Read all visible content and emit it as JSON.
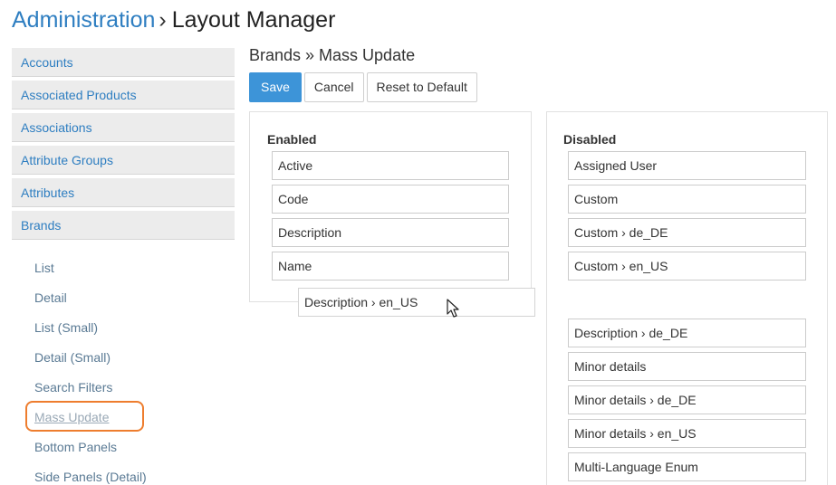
{
  "header": {
    "root": "Administration",
    "separator": "›",
    "current": "Layout Manager"
  },
  "scopes": [
    {
      "label": "Accounts"
    },
    {
      "label": "Associated Products"
    },
    {
      "label": "Associations"
    },
    {
      "label": "Attribute Groups"
    },
    {
      "label": "Attributes"
    },
    {
      "label": "Brands"
    }
  ],
  "layout_types": [
    {
      "label": "List"
    },
    {
      "label": "Detail"
    },
    {
      "label": "List (Small)"
    },
    {
      "label": "Detail (Small)"
    },
    {
      "label": "Search Filters"
    },
    {
      "label": "Mass Update"
    },
    {
      "label": "Bottom Panels"
    },
    {
      "label": "Side Panels (Detail)"
    }
  ],
  "active_layout_type": "Mass Update",
  "section_title": "Brands » Mass Update",
  "toolbar": {
    "save_label": "Save",
    "cancel_label": "Cancel",
    "reset_label": "Reset to Default"
  },
  "enabled": {
    "title": "Enabled",
    "fields": [
      "Active",
      "Code",
      "Description",
      "Name"
    ]
  },
  "dragging_field": "Description › en_US",
  "disabled": {
    "title": "Disabled",
    "fields": [
      "Assigned User",
      "Custom",
      "Custom › de_DE",
      "Custom › en_US",
      "Description › de_DE",
      "Minor details",
      "Minor details › de_DE",
      "Minor details › en_US",
      "Multi-Language Enum"
    ]
  },
  "colors": {
    "link": "#2e7ec1",
    "primary_button": "#3d94d8",
    "highlight_outline": "#ee7d2e",
    "sidebar_item_bg": "#ececec"
  }
}
